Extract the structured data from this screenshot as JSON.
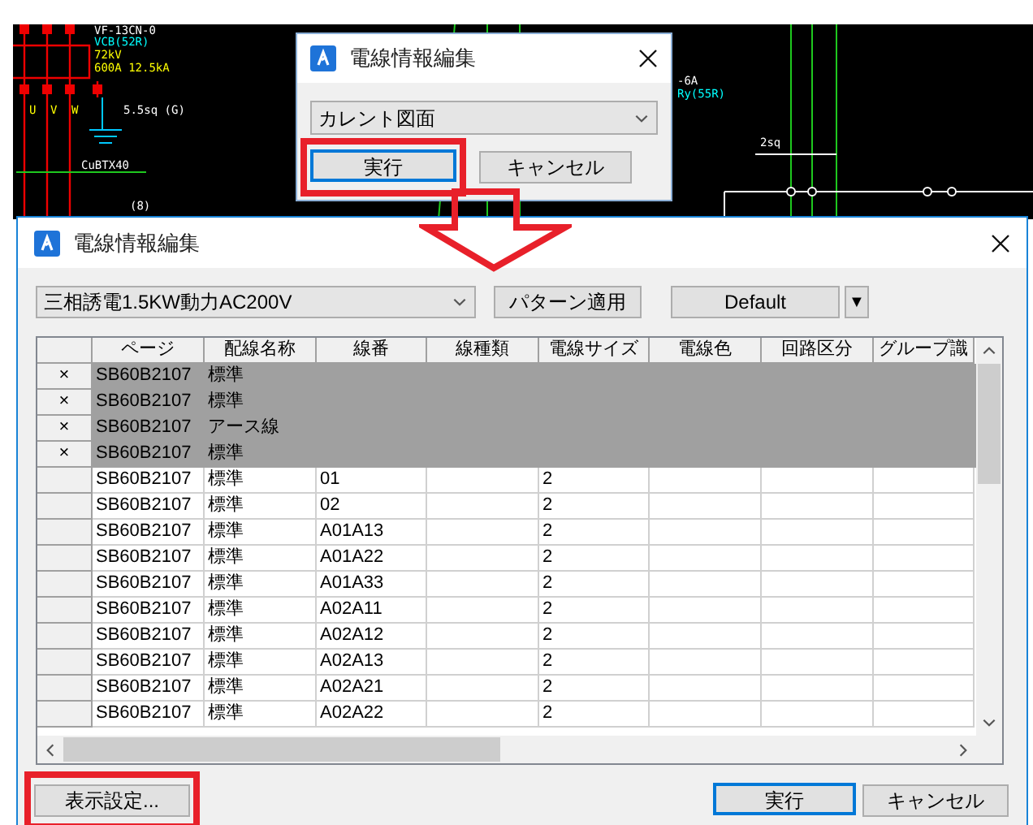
{
  "cad_labels": [
    {
      "text": "VF-13CN-0",
      "color": "#ffffff"
    },
    {
      "text": "VCB(52R)",
      "color": "#00ffff"
    },
    {
      "text": "72kV",
      "color": "#ffff00"
    },
    {
      "text": "600A 12.5kA",
      "color": "#ffff00"
    },
    {
      "text": "U",
      "color": "#ffff00"
    },
    {
      "text": "V",
      "color": "#ffff00"
    },
    {
      "text": "W",
      "color": "#ffff00"
    },
    {
      "text": "5.5sq (G)",
      "color": "#ffffff"
    },
    {
      "text": "CuBTX40",
      "color": "#ffffff"
    },
    {
      "text": "(8)",
      "color": "#ffffff"
    },
    {
      "text": "-6A",
      "color": "#ffffff"
    },
    {
      "text": "Ry(55R)",
      "color": "#00ffff"
    },
    {
      "text": "2sq",
      "color": "#ffffff"
    }
  ],
  "small_dialog": {
    "title": "電線情報編集",
    "dropdown": "カレント図面",
    "buttons": [
      {
        "label": "実行",
        "default": true,
        "highlighted": true
      },
      {
        "label": "キャンセル",
        "default": false,
        "highlighted": false
      }
    ]
  },
  "dialog": {
    "title": "電線情報編集",
    "pattern_select": "三相誘電1.5KW動力AC200V",
    "apply_button": "パターン適用",
    "preset": "Default",
    "preset_arrow": "▼",
    "table": {
      "columns": [
        "ページ",
        "配線名称",
        "線番",
        "線種類",
        "電線サイズ",
        "電線色",
        "回路区分",
        "グループ識"
      ],
      "rows": [
        {
          "selected": true,
          "mark": "×",
          "page": "SB60B2107",
          "name": "標準"
        },
        {
          "selected": true,
          "mark": "×",
          "page": "SB60B2107",
          "name": "標準"
        },
        {
          "selected": true,
          "mark": "×",
          "page": "SB60B2107",
          "name": "アース線"
        },
        {
          "selected": true,
          "mark": "×",
          "page": "SB60B2107",
          "name": "標準"
        },
        {
          "selected": false,
          "page": "SB60B2107",
          "name": "標準",
          "number": "01",
          "size": "2"
        },
        {
          "selected": false,
          "page": "SB60B2107",
          "name": "標準",
          "number": "02",
          "size": "2"
        },
        {
          "selected": false,
          "page": "SB60B2107",
          "name": "標準",
          "number": "A01A13",
          "size": "2"
        },
        {
          "selected": false,
          "page": "SB60B2107",
          "name": "標準",
          "number": "A01A22",
          "size": "2"
        },
        {
          "selected": false,
          "page": "SB60B2107",
          "name": "標準",
          "number": "A01A33",
          "size": "2"
        },
        {
          "selected": false,
          "page": "SB60B2107",
          "name": "標準",
          "number": "A02A11",
          "size": "2"
        },
        {
          "selected": false,
          "page": "SB60B2107",
          "name": "標準",
          "number": "A02A12",
          "size": "2"
        },
        {
          "selected": false,
          "page": "SB60B2107",
          "name": "標準",
          "number": "A02A13",
          "size": "2"
        },
        {
          "selected": false,
          "page": "SB60B2107",
          "name": "標準",
          "number": "A02A21",
          "size": "2"
        },
        {
          "selected": false,
          "page": "SB60B2107",
          "name": "標準",
          "number": "A02A22",
          "size": "2"
        }
      ]
    },
    "settings_button": {
      "label": "表示設定...",
      "default": false,
      "highlighted": true
    },
    "buttons": [
      {
        "label": "実行",
        "default": true,
        "highlighted": false
      },
      {
        "label": "キャンセル",
        "default": false,
        "highlighted": false
      }
    ]
  }
}
